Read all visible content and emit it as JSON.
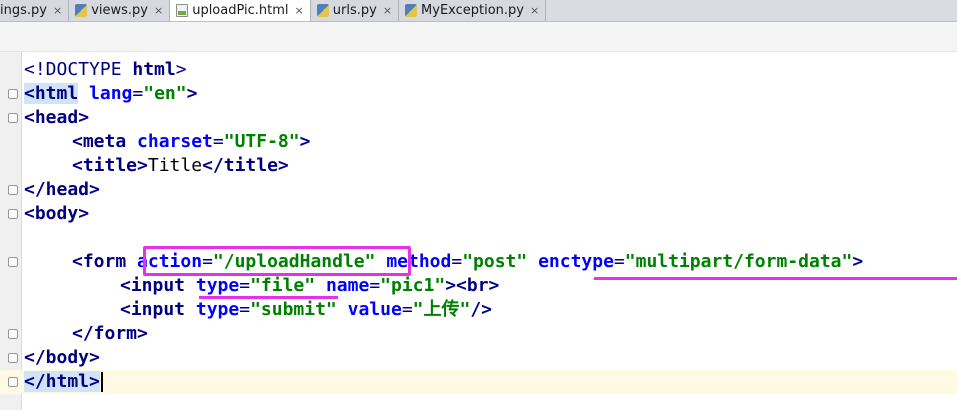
{
  "tabs": [
    {
      "label": "ings.py",
      "icon": "python-file-icon",
      "active": false
    },
    {
      "label": "views.py",
      "icon": "python-file-icon",
      "active": false
    },
    {
      "label": "uploadPic.html",
      "icon": "html-file-icon",
      "active": true
    },
    {
      "label": "urls.py",
      "icon": "python-file-icon",
      "active": false
    },
    {
      "label": "MyException.py",
      "icon": "python-file-icon",
      "active": false
    }
  ],
  "close_glyph": "×",
  "code": {
    "l1": {
      "a": "<!DOCTYPE ",
      "b": "html",
      "c": ">"
    },
    "l2": {
      "tag": "<html",
      "attr": "lang",
      "eq": "=",
      "val": "\"en\"",
      "end": ">"
    },
    "l3": {
      "tag": "<head",
      "end": ">"
    },
    "l4": {
      "tag": "<meta",
      "attr": "charset",
      "eq": "=",
      "val": "\"UTF-8\"",
      "end": ">"
    },
    "l5": {
      "tag": "<title",
      "gt": ">",
      "text": "Title",
      "ctag": "</title",
      "end": ">"
    },
    "l6": {
      "tag": "</head",
      "end": ">"
    },
    "l7": {
      "tag": "<body",
      "end": ">"
    },
    "l9": {
      "tag": "<form",
      "a1": "action",
      "v1": "\"/uploadHandle\"",
      "a2": "method",
      "v2": "\"post\"",
      "a3": "enctype",
      "v3": "\"multipart/form-data\"",
      "eq": "=",
      "end": ">"
    },
    "l10": {
      "tag": "<input",
      "a1": "type",
      "v1": "\"file\"",
      "a2": "name",
      "v2": "\"pic1\"",
      "gt": ">",
      "br": "<br",
      "end": ">"
    },
    "l11": {
      "tag": "<input",
      "a1": "type",
      "v1": "\"submit\"",
      "a2": "value",
      "v2": "\"上传\"",
      "end": "/>"
    },
    "l12": {
      "tag": "</form",
      "end": ">"
    },
    "l13": {
      "tag": "</body",
      "end": ">"
    },
    "l14": {
      "tag": "</html",
      "end": ">"
    }
  },
  "colors": {
    "annotation": "#e632e6",
    "tag": "#000080",
    "attribute": "#0000ff",
    "string": "#008000",
    "current_line": "#fffae3"
  }
}
